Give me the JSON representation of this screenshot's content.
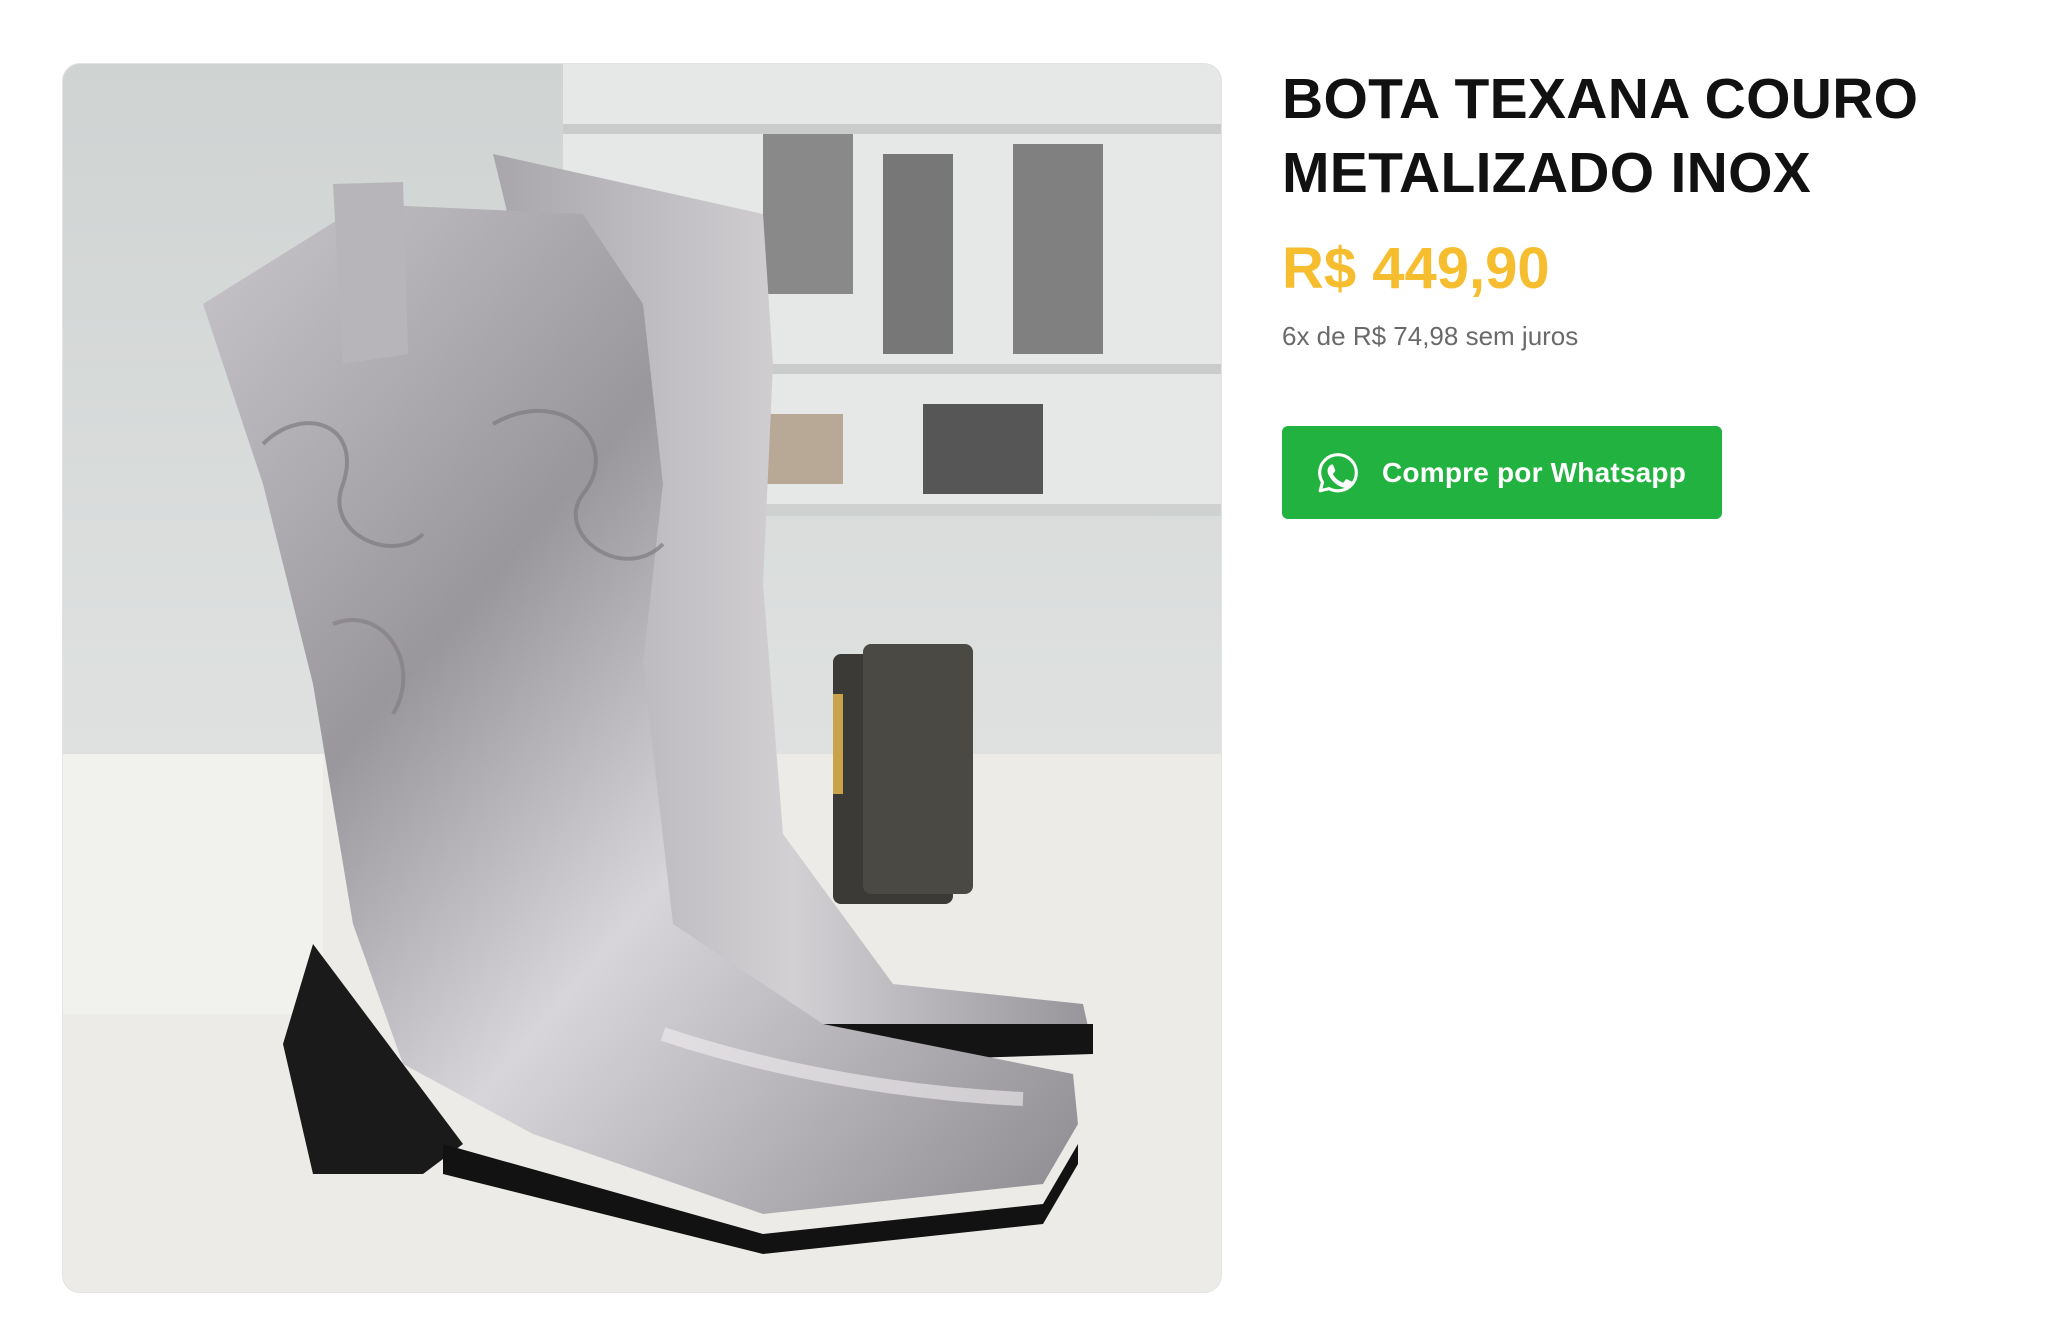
{
  "product": {
    "title": "BOTA TEXANA COURO METALIZADO INOX",
    "price": "R$ 449,90",
    "installments": "6x de R$ 74,98 sem juros",
    "image_icon": "product-photo-cowboy-boots"
  },
  "actions": {
    "whatsapp_label": "Compre por Whatsapp",
    "whatsapp_icon": "whatsapp-icon"
  },
  "colors": {
    "price": "#f6bd2f",
    "whatsapp_button": "#22b240",
    "title": "#111111",
    "installments": "#6a6a6a"
  }
}
